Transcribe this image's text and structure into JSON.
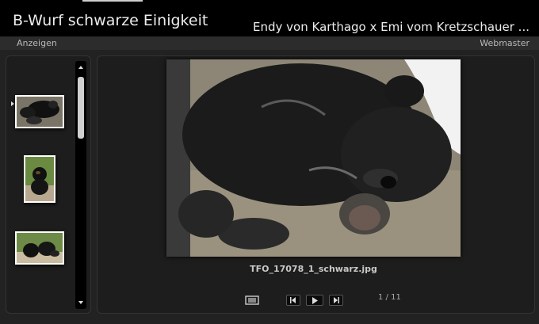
{
  "header": {
    "title": "B-Wurf schwarze Einigkeit",
    "subtitle": "Endy von Karthago x Emi vom Kretzschauer ..."
  },
  "nav": {
    "left_link": "Anzeigen",
    "right_link": "Webmaster"
  },
  "gallery": {
    "caption": "TFO_17078_1_schwarz.jpg",
    "counter": "1 / 11",
    "current_index": 1,
    "total": 11
  },
  "icons": {
    "screen": "slideshow-screen-icon",
    "prev": "previous-icon",
    "play": "play-icon",
    "next": "next-icon"
  }
}
